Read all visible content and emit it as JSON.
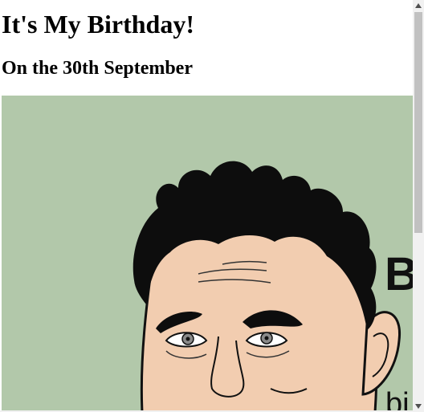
{
  "page": {
    "heading": "It's My Birthday!",
    "subheading": "On the 30th September"
  },
  "illustration": {
    "visible_text": "B",
    "visible_text_partial": "bi",
    "background_color": "#b2c8aa",
    "skin_color": "#f2cdb0",
    "hair_color": "#0d0d0d"
  },
  "scrollbar": {
    "up_arrow_icon": "triangle-up-icon",
    "down_arrow_icon": "triangle-down-icon"
  }
}
